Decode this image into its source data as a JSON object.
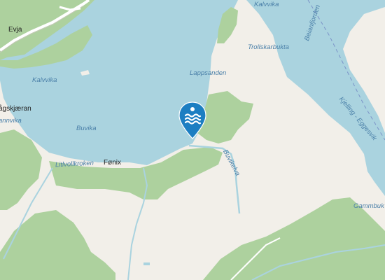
{
  "map": {
    "colors": {
      "water": "#aad3df",
      "land": "#f2efe9",
      "forest": "#add19e",
      "pin": "#1c7ec2"
    },
    "places": [
      {
        "key": "evja",
        "name": "Evja"
      },
      {
        "key": "agskjaeran",
        "name": "ågskjæran"
      },
      {
        "key": "fonix",
        "name": "Fønix"
      }
    ],
    "water_labels": [
      {
        "key": "kalvvika-ne",
        "name": "Kalvvika"
      },
      {
        "key": "kalvvika-w",
        "name": "Kalvvika"
      },
      {
        "key": "trollskarbukta",
        "name": "Trollskarbukta"
      },
      {
        "key": "lappsanden",
        "name": "Lappsanden"
      },
      {
        "key": "buvika",
        "name": "Buvika"
      },
      {
        "key": "litlvollkroken",
        "name": "Litlvollkroken"
      },
      {
        "key": "buvikelva",
        "name": "Buvikelva"
      },
      {
        "key": "annvika",
        "name": "annvika"
      },
      {
        "key": "beianfjorden",
        "name": "Beianfjorden"
      },
      {
        "key": "kjelling-eggesvik",
        "name": "Kjelling - Eggesvik"
      },
      {
        "key": "gammbukta",
        "name": "Gammbuk"
      }
    ],
    "marker": {
      "icon": "swimming-icon",
      "type": "bathing-spot"
    }
  }
}
